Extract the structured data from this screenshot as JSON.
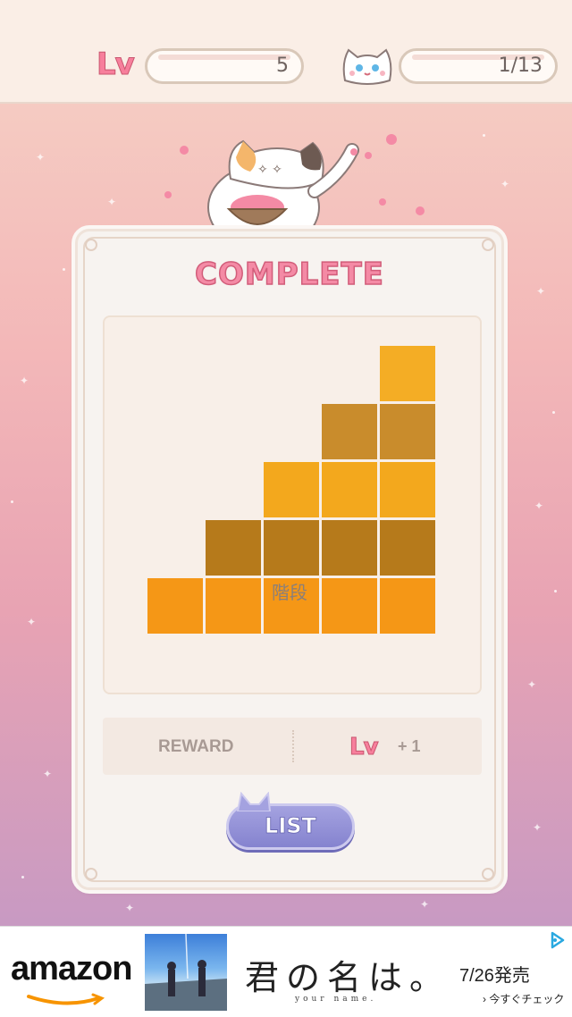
{
  "header": {
    "level_badge": "Lv",
    "level_value": "5",
    "cat_progress": "1/13"
  },
  "card": {
    "title": "COMPLETE",
    "puzzle_name": "階段",
    "grid": {
      "rows": 5,
      "cols": 5,
      "cells": [
        [
          "",
          "",
          "",
          "",
          "#f4ad25"
        ],
        [
          "",
          "",
          "",
          "#c98c2c",
          "#c98c2c"
        ],
        [
          "",
          "",
          "#f3a81d",
          "#f3a81d",
          "#f3a81d"
        ],
        [
          "",
          "#b67a1b",
          "#b67a1b",
          "#b67a1b",
          "#b67a1b"
        ],
        [
          "#f59716",
          "#f59716",
          "#f59716",
          "#f59716",
          "#f59716"
        ]
      ]
    },
    "reward": {
      "label": "REWARD",
      "icon_text": "Lv",
      "value": "+ 1"
    },
    "list_button": "LIST"
  },
  "ad": {
    "brand": "amazon",
    "title": "君の名は。",
    "subtitle": "your name.",
    "date": "7/26発売",
    "cta": "› 今すぐチェック"
  },
  "colors": {
    "accent_pink": "#f48aa5",
    "list_button": "#8f8dd6",
    "card_bg": "#f7f3f0"
  }
}
